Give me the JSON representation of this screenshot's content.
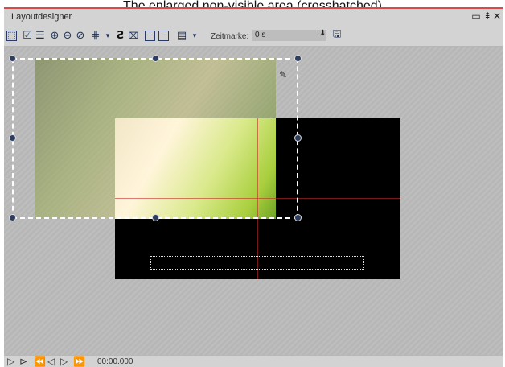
{
  "caption": "The enlarged non-visible area (crosshatched)",
  "window": {
    "title": "Layoutdesigner",
    "controls": [
      "▭",
      "⇞",
      "✕"
    ]
  },
  "toolbar": {
    "zeitmarke_label": "Zeitmarke:",
    "zeitmarke_value": "0 s",
    "icons": [
      "select-icon",
      "check-icon",
      "list-icon",
      "zoom-in-icon",
      "zoom-out-icon",
      "zoom-fit-icon",
      "grid-icon",
      "curve-icon",
      "text-frame-icon",
      "plus-box-icon",
      "minus-box-icon",
      "align-icon",
      "save-icon"
    ]
  },
  "status": {
    "timecode": "00:00.000"
  },
  "colors": {
    "accent_red": "#d84a4a",
    "handle": "#2e3e5e",
    "canvas": "#b7b7b7"
  }
}
